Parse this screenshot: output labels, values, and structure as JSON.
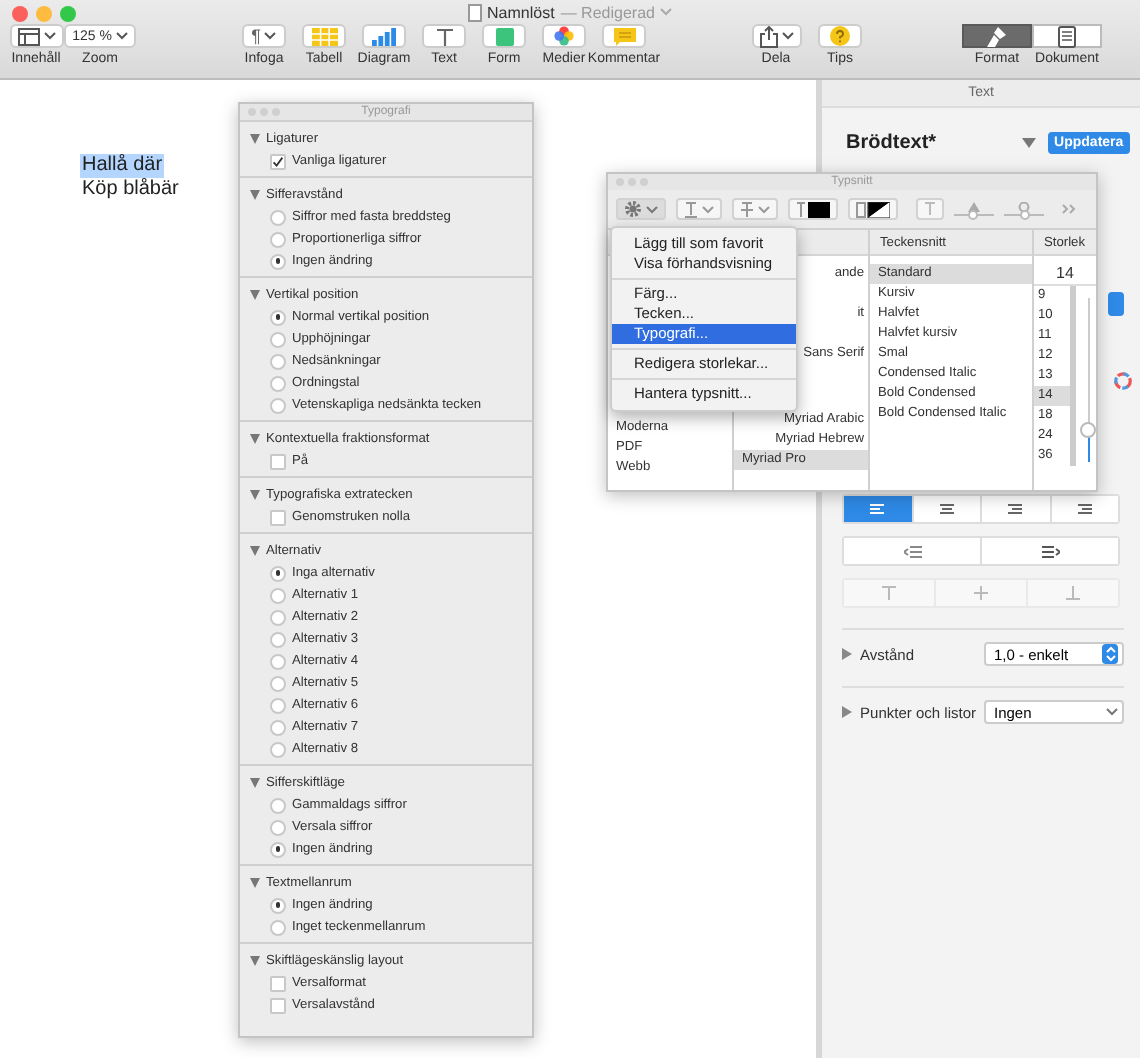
{
  "window": {
    "title": "Namnlöst",
    "subtitle": "— Redigerad"
  },
  "toolbar": {
    "left": [
      {
        "kind": "layout",
        "label": "Innehåll"
      },
      {
        "kind": "zoom",
        "label": "Zoom",
        "value": "125 %"
      }
    ],
    "center": [
      {
        "kind": "paragraph",
        "label": "Infoga",
        "glyph": "¶"
      },
      {
        "kind": "table",
        "label": "Tabell"
      },
      {
        "kind": "chart",
        "label": "Diagram"
      },
      {
        "kind": "text",
        "label": "Text"
      },
      {
        "kind": "shape",
        "label": "Form"
      },
      {
        "kind": "media",
        "label": "Medier"
      },
      {
        "kind": "comment",
        "label": "Kommentar"
      }
    ],
    "right": [
      {
        "kind": "share",
        "label": "Dela"
      },
      {
        "kind": "tips",
        "label": "Tips"
      }
    ],
    "view_switch": [
      {
        "kind": "brush",
        "label": "Format",
        "selected": true
      },
      {
        "kind": "document",
        "label": "Dokument",
        "selected": false
      }
    ]
  },
  "document": {
    "lines": [
      {
        "text": "Hallå där",
        "selected": true
      },
      {
        "text": "Köp blåbär",
        "selected": false
      }
    ]
  },
  "sidebar": {
    "tab": "Text",
    "style": "Brödtext*",
    "update_button": "Uppdatera",
    "alignment": [
      {
        "selected": true
      },
      {
        "selected": false
      },
      {
        "selected": false
      },
      {
        "selected": false
      }
    ],
    "vertical_align": {
      "disabled": true
    },
    "rows": [
      {
        "label": "Avstånd",
        "expanded": false,
        "value": "1,0 - enkelt",
        "kind": "stepper"
      },
      {
        "label": "Punkter och listor",
        "expanded": false,
        "value": "Ingen",
        "kind": "dropdown"
      }
    ]
  },
  "typography_panel": {
    "title": "Typografi",
    "sections": [
      {
        "title": "Ligaturer",
        "expanded": true,
        "items": [
          {
            "kind": "checkbox",
            "label": "Vanliga ligaturer",
            "checked": true
          }
        ]
      },
      {
        "title": "Sifferavstånd",
        "expanded": true,
        "items": [
          {
            "kind": "radio",
            "label": "Siffror med fasta breddsteg",
            "checked": false
          },
          {
            "kind": "radio",
            "label": "Proportionerliga siffror",
            "checked": false
          },
          {
            "kind": "radio",
            "label": "Ingen ändring",
            "checked": true
          }
        ]
      },
      {
        "title": "Vertikal position",
        "expanded": true,
        "items": [
          {
            "kind": "radio",
            "label": "Normal vertikal position",
            "checked": true
          },
          {
            "kind": "radio",
            "label": "Upphöjningar",
            "checked": false
          },
          {
            "kind": "radio",
            "label": "Nedsänkningar",
            "checked": false
          },
          {
            "kind": "radio",
            "label": "Ordningstal",
            "checked": false
          },
          {
            "kind": "radio",
            "label": "Vetenskapliga nedsänkta tecken",
            "checked": false
          }
        ]
      },
      {
        "title": "Kontextuella fraktionsformat",
        "expanded": true,
        "items": [
          {
            "kind": "checkbox",
            "label": "På",
            "checked": false
          }
        ]
      },
      {
        "title": "Typografiska extratecken",
        "expanded": true,
        "items": [
          {
            "kind": "checkbox",
            "label": "Genomstruken nolla",
            "checked": false
          }
        ]
      },
      {
        "title": "Alternativ",
        "expanded": true,
        "items": [
          {
            "kind": "radio",
            "label": "Inga alternativ",
            "checked": true
          },
          {
            "kind": "radio",
            "label": "Alternativ 1",
            "checked": false
          },
          {
            "kind": "radio",
            "label": "Alternativ 2",
            "checked": false
          },
          {
            "kind": "radio",
            "label": "Alternativ 3",
            "checked": false
          },
          {
            "kind": "radio",
            "label": "Alternativ 4",
            "checked": false
          },
          {
            "kind": "radio",
            "label": "Alternativ 5",
            "checked": false
          },
          {
            "kind": "radio",
            "label": "Alternativ 6",
            "checked": false
          },
          {
            "kind": "radio",
            "label": "Alternativ 7",
            "checked": false
          },
          {
            "kind": "radio",
            "label": "Alternativ 8",
            "checked": false
          }
        ]
      },
      {
        "title": "Sifferskiftläge",
        "expanded": true,
        "items": [
          {
            "kind": "radio",
            "label": "Gammaldags siffror",
            "checked": false
          },
          {
            "kind": "radio",
            "label": "Versala siffror",
            "checked": false
          },
          {
            "kind": "radio",
            "label": "Ingen ändring",
            "checked": true
          }
        ]
      },
      {
        "title": "Textmellanrum",
        "expanded": true,
        "items": [
          {
            "kind": "radio",
            "label": "Ingen ändring",
            "checked": true
          },
          {
            "kind": "radio",
            "label": "Inget teckenmellanrum",
            "checked": false
          }
        ]
      },
      {
        "title": "Skiftlägeskänslig layout",
        "expanded": true,
        "items": [
          {
            "kind": "checkbox",
            "label": "Versalformat",
            "checked": false
          },
          {
            "kind": "checkbox",
            "label": "Versalavstånd",
            "checked": false
          }
        ]
      }
    ]
  },
  "fonts_panel": {
    "title": "Typsnitt",
    "shadow_sliders": [
      {
        "level": 0.45
      },
      {
        "level": 0.5
      }
    ],
    "collections": [
      "Moderna",
      "PDF",
      "Webb"
    ],
    "families": [
      {
        "name": "ande",
        "selected": false
      },
      {
        "name": "it",
        "selected": false
      },
      {
        "name": "Sans Serif",
        "selected": false
      },
      {
        "name": "Myriad Arabic",
        "selected": false
      },
      {
        "name": "Myriad Hebrew",
        "selected": false
      },
      {
        "name": "Myriad Pro",
        "selected": true
      }
    ],
    "typeface_header": "Teckensnitt",
    "typefaces": [
      {
        "name": "Standard",
        "selected": true
      },
      {
        "name": "Kursiv",
        "selected": false
      },
      {
        "name": "Halvfet",
        "selected": false
      },
      {
        "name": "Halvfet kursiv",
        "selected": false
      },
      {
        "name": "Smal",
        "selected": false
      },
      {
        "name": "Condensed Italic",
        "selected": false
      },
      {
        "name": "Bold Condensed",
        "selected": false
      },
      {
        "name": "Bold Condensed Italic",
        "selected": false
      }
    ],
    "size_header": "Storlek",
    "size_value": "14",
    "sizes": [
      {
        "value": "9",
        "selected": false
      },
      {
        "value": "10",
        "selected": false
      },
      {
        "value": "11",
        "selected": false
      },
      {
        "value": "12",
        "selected": false
      },
      {
        "value": "13",
        "selected": false
      },
      {
        "value": "14",
        "selected": true
      },
      {
        "value": "18",
        "selected": false
      },
      {
        "value": "24",
        "selected": false
      },
      {
        "value": "36",
        "selected": false
      }
    ],
    "size_slider": {
      "level": 0.2
    }
  },
  "action_menu": {
    "items": [
      {
        "kind": "item",
        "label": "Lägg till som favorit",
        "selected": false
      },
      {
        "kind": "item",
        "label": "Visa förhandsvisning",
        "selected": false
      },
      {
        "kind": "separator"
      },
      {
        "kind": "item",
        "label": "Färg...",
        "selected": false
      },
      {
        "kind": "item",
        "label": "Tecken...",
        "selected": false
      },
      {
        "kind": "item",
        "label": "Typografi...",
        "selected": true
      },
      {
        "kind": "separator"
      },
      {
        "kind": "item",
        "label": "Redigera storlekar...",
        "selected": false
      },
      {
        "kind": "separator"
      },
      {
        "kind": "item",
        "label": "Hantera typsnitt...",
        "selected": false
      }
    ]
  }
}
